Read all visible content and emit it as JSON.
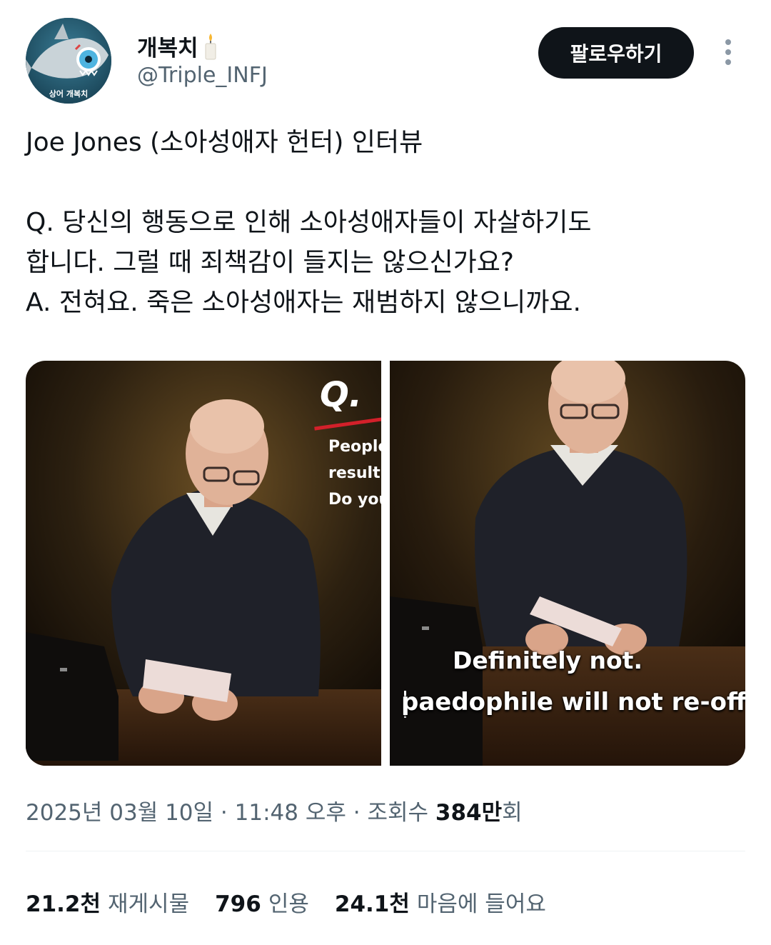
{
  "user": {
    "display_name": "개복치",
    "handle": "@Triple_INFJ",
    "avatar_caption": "상어 개복치",
    "name_emoji": "candle-icon"
  },
  "actions": {
    "follow_label": "팔로우하기",
    "more_icon": "more-vertical-icon"
  },
  "tweet": {
    "lines": [
      "Joe Jones (소아성애자 헌터) 인터뷰",
      "",
      "Q. 당신의 행동으로 인해 소아성애자들이 자살하기도",
      "합니다. 그럴 때 죄책감이 들지는 않으신가요?",
      "A. 전혀요. 죽은 소아성애자는 재범하지 않으니까요."
    ]
  },
  "media": {
    "left": {
      "q_mark": "Q.",
      "q_lines": [
        "People",
        "result",
        "Do you"
      ]
    },
    "right": {
      "subtitle_1": "Definitely not.",
      "subtitle_2": "paedophile will not re-offen"
    }
  },
  "meta": {
    "date": "2025년 03월 10일",
    "time": "11:48 오후",
    "views_label": "조회수",
    "views_value": "384만",
    "views_suffix": "회",
    "separator": "·"
  },
  "stats": [
    {
      "value": "21.2천",
      "label": "재게시물"
    },
    {
      "value": "796",
      "label": "인용"
    },
    {
      "value": "24.1천",
      "label": "마음에 들어요"
    }
  ],
  "colors": {
    "text_primary": "#0f1419",
    "text_secondary": "#536471",
    "follow_bg": "#0f1419",
    "divider": "#eff3f4",
    "q_underline": "#d3202a"
  }
}
